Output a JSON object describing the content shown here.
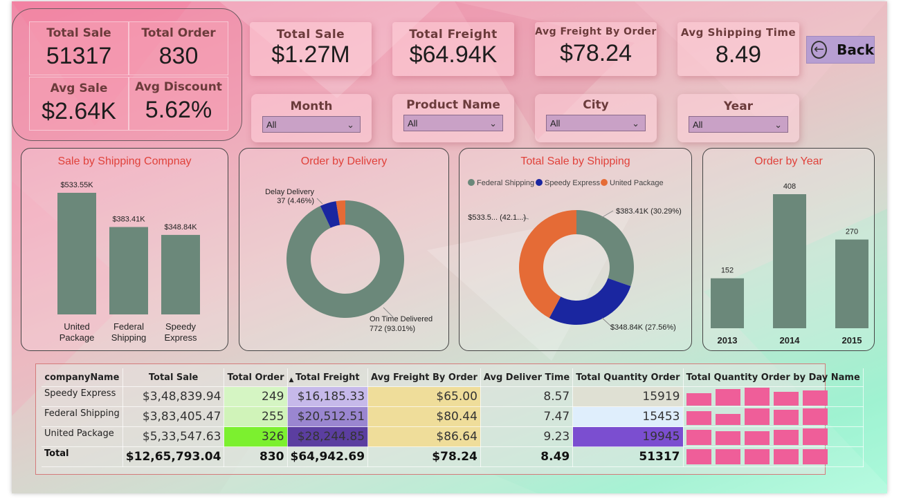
{
  "kpi_group": {
    "total_sale": {
      "label": "Total Sale",
      "value": "51317"
    },
    "total_order": {
      "label": "Total Order",
      "value": "830"
    },
    "avg_sale": {
      "label": "Avg Sale",
      "value": "$2.64K"
    },
    "avg_discount": {
      "label": "Avg Discount",
      "value": "5.62%"
    }
  },
  "kpi_cards": [
    {
      "label": "Total Sale",
      "value": "$1.27M"
    },
    {
      "label": "Total Freight",
      "value": "$64.94K"
    },
    {
      "label": "Avg Freight By Order",
      "value": "$78.24"
    },
    {
      "label": "Avg Shipping Time",
      "value": "8.49"
    }
  ],
  "slicers": [
    {
      "label": "Month",
      "selected": "All"
    },
    {
      "label": "Product Name",
      "selected": "All"
    },
    {
      "label": "City",
      "selected": "All"
    },
    {
      "label": "Year",
      "selected": "All"
    }
  ],
  "back_button": {
    "label": "Back"
  },
  "colors": {
    "bar": "#6b887a",
    "gray": "#6b887a",
    "blue": "#1a26a0",
    "orange": "#e56b36",
    "title": "#e0413a",
    "pink_square": "#ef5e99"
  },
  "chart_data": [
    {
      "type": "bar",
      "title": "Sale by Shipping Compnay",
      "categories": [
        "United Package",
        "Federal Shipping",
        "Speedy Express"
      ],
      "category_lines": [
        [
          "United",
          "Package"
        ],
        [
          "Federal",
          "Shipping"
        ],
        [
          "Speedy",
          "Express"
        ]
      ],
      "values": [
        533550,
        383410,
        348840
      ],
      "data_labels": [
        "$533.55K",
        "$383.41K",
        "$348.84K"
      ],
      "ylim": [
        0,
        533550
      ]
    },
    {
      "type": "pie",
      "title": "Order by Delivery",
      "slices": [
        {
          "name": "On Time Delivered",
          "value": 772,
          "label": "772 (93.01%)"
        },
        {
          "name": "Delay Delivery",
          "value": 37,
          "label": "37 (4.46%)"
        },
        {
          "name": "",
          "value": 21,
          "label": ""
        }
      ]
    },
    {
      "type": "pie",
      "title": "Total Sale by Shipping",
      "legend": [
        "Federal Shipping",
        "Speedy Express",
        "United Package"
      ],
      "slices": [
        {
          "name": "Federal Shipping",
          "value": 30.29,
          "label": "$383.41K (30.29%)"
        },
        {
          "name": "Speedy Express",
          "value": 27.56,
          "label": "$348.84K (27.56%)"
        },
        {
          "name": "United Package",
          "value": 42.15,
          "label": "$533.5... (42.1...)"
        }
      ]
    },
    {
      "type": "bar",
      "title": "Order by Year",
      "categories": [
        "2013",
        "2014",
        "2015"
      ],
      "values": [
        152,
        408,
        270
      ],
      "data_labels": [
        "152",
        "408",
        "270"
      ],
      "ylim": [
        0,
        408
      ]
    }
  ],
  "table": {
    "columns": [
      "companyName",
      "Total Sale",
      "Total Order",
      "Total Freight",
      "Avg Freight By Order",
      "Avg Deliver Time",
      "Total Quantity Order",
      "Total Quantity Order by Day Name"
    ],
    "rows": [
      {
        "name": "Speedy Express",
        "sale": "$3,48,839.94",
        "order": "249",
        "freight": "$16,185.33",
        "avg_freight": "$65.00",
        "deliver": "8.57",
        "qty": "15919"
      },
      {
        "name": "Federal Shipping",
        "sale": "$3,83,405.47",
        "order": "255",
        "freight": "$20,512.51",
        "avg_freight": "$80.44",
        "deliver": "7.47",
        "qty": "15453"
      },
      {
        "name": "United Package",
        "sale": "$5,33,547.63",
        "order": "326",
        "freight": "$28,244.85",
        "avg_freight": "$86.64",
        "deliver": "9.23",
        "qty": "19945"
      }
    ],
    "total": {
      "name": "Total",
      "sale": "$12,65,793.04",
      "order": "830",
      "freight": "$64,942.69",
      "avg_freight": "$78.24",
      "deliver": "8.49",
      "qty": "51317"
    }
  }
}
